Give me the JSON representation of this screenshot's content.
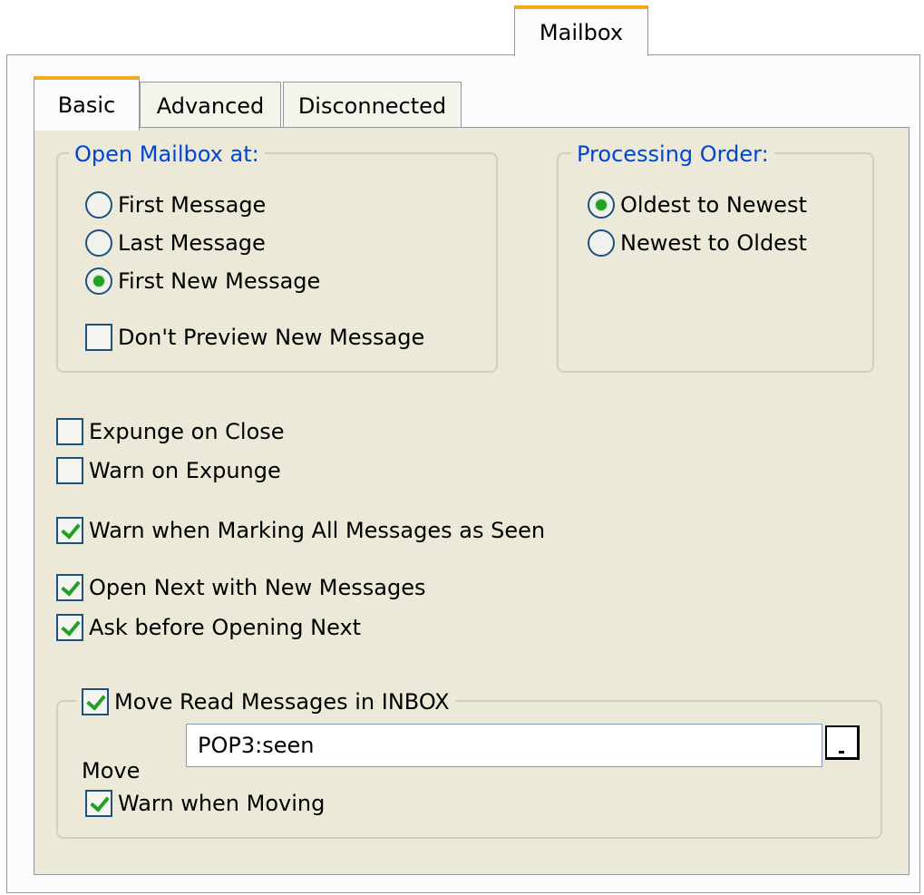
{
  "top_tab": {
    "label": "Mailbox"
  },
  "tabs": [
    {
      "label": "Basic",
      "active": true
    },
    {
      "label": "Advanced",
      "active": false
    },
    {
      "label": "Disconnected",
      "active": false
    }
  ],
  "open_at": {
    "title": "Open Mailbox at:",
    "options": [
      {
        "label": "First Message",
        "selected": false
      },
      {
        "label": "Last Message",
        "selected": false
      },
      {
        "label": "First New Message",
        "selected": true
      }
    ],
    "dont_preview": {
      "label": "Don't Preview New Message",
      "checked": false
    }
  },
  "processing": {
    "title": "Processing Order:",
    "options": [
      {
        "label": "Oldest to Newest",
        "selected": true
      },
      {
        "label": "Newest to Oldest",
        "selected": false
      }
    ]
  },
  "checks": {
    "expunge_on_close": {
      "label": "Expunge on Close",
      "checked": false
    },
    "warn_on_expunge": {
      "label": "Warn on Expunge",
      "checked": false
    },
    "warn_marking_seen": {
      "label": "Warn when Marking All Messages as Seen",
      "checked": true
    },
    "open_next": {
      "label": "Open Next with New Messages",
      "checked": true
    },
    "ask_before_next": {
      "label": "Ask before Opening Next",
      "checked": true
    }
  },
  "move_group": {
    "title": {
      "label": "Move Read Messages in INBOX",
      "checked": true
    },
    "move_label": "Move",
    "move_value": "POP3:seen",
    "warn_moving": {
      "label": "Warn when Moving",
      "checked": true
    }
  },
  "colors": {
    "accent": "#f5a81c",
    "group_title": "#0046d5",
    "panel": "#ece9d8",
    "check": "#21a121"
  }
}
